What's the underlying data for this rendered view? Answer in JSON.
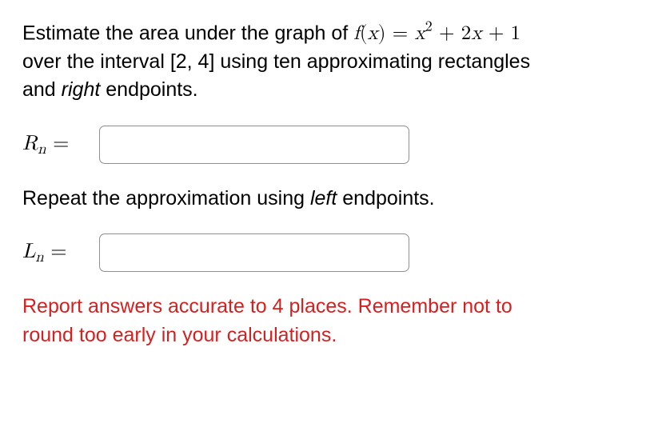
{
  "problem": {
    "line1_pre": "Estimate the area under the graph of ",
    "func_lhs_f": "f",
    "func_lhs_paren_open": "(",
    "func_lhs_x": "x",
    "func_lhs_paren_close": ")",
    "eq": " = ",
    "term_x": "x",
    "term_exp": "2",
    "plus1": " + 2",
    "term_x2": "x",
    "plus2": " + 1",
    "line2": "over the interval [2, 4] using ten approximating rectangles",
    "line3_pre": "and ",
    "line3_em": "right",
    "line3_post": " endpoints."
  },
  "rn": {
    "R": "R",
    "sub": "n",
    "eq": " =",
    "value": ""
  },
  "repeat": {
    "pre": "Repeat the approximation using ",
    "em": "left",
    "post": " endpoints."
  },
  "ln": {
    "L": "L",
    "sub": "n",
    "eq": " =",
    "value": ""
  },
  "note": {
    "l1": "Report answers accurate to 4 places. Remember not to",
    "l2": "round too early in your calculations."
  }
}
